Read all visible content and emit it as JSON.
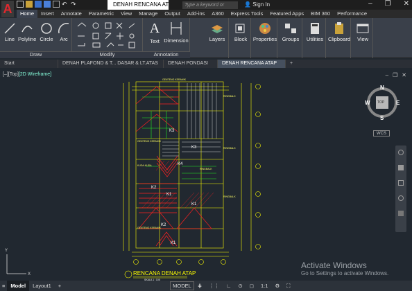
{
  "titlebar": {
    "doc_title": "DENAH RENCANA ATAP ...",
    "search_placeholder": "Type a keyword or phrase",
    "signin": "Sign In"
  },
  "ribbon_tabs": [
    "Home",
    "Insert",
    "Annotate",
    "Parametric",
    "View",
    "Manage",
    "Output",
    "Add-ins",
    "A360",
    "Express Tools",
    "Featured Apps",
    "BIM 360",
    "Performance"
  ],
  "ribbon": {
    "draw": {
      "label": "Draw",
      "tools": [
        "Line",
        "Polyline",
        "Circle",
        "Arc"
      ]
    },
    "modify": {
      "label": "Modify"
    },
    "annotation": {
      "label": "Annotation",
      "tools": [
        "Text",
        "Dimension"
      ]
    },
    "layers": "Layers",
    "block": "Block",
    "properties": "Properties",
    "groups": "Groups",
    "utilities": "Utilities",
    "clipboard": "Clipboard",
    "view": "View"
  },
  "doc_tabs": [
    "Start",
    "DENAH PLAFOND & T... DASAR & LT.ATAS",
    "DENAH PONDASI",
    "DENAH RENCANA ATAP"
  ],
  "viewport": {
    "label_prefix": "[–][Top]",
    "visual_style": "[2D Wireframe]"
  },
  "viewcube": {
    "n": "N",
    "s": "S",
    "e": "E",
    "w": "W",
    "top": "TOP",
    "wcs": "WCS"
  },
  "drawing": {
    "title": "RENCANA DENAH ATAP",
    "scale": "SKALA 1 : 100",
    "rooms": [
      "K3",
      "K3",
      "K4",
      "K2",
      "K1",
      "K1",
      "K2",
      "K1"
    ],
    "notes": [
      "GENTENG KERAMIK",
      "GENTENG KERAMIK",
      "RINGBALK",
      "RINGBALK",
      "RINGBALK",
      "KUDA-KUDA",
      "RINGBALK",
      "GENTENG KERAMIK"
    ]
  },
  "activate": {
    "line1": "Activate Windows",
    "line2": "Go to Settings to activate Windows."
  },
  "status": {
    "model": "Model",
    "layout1": "Layout1",
    "model_btn": "MODEL",
    "scale": "1:1"
  }
}
